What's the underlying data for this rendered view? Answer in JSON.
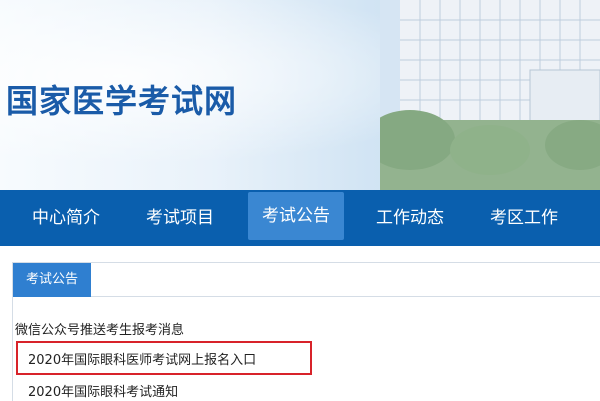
{
  "header": {
    "site_title": "国家医学考试网"
  },
  "nav": {
    "items": [
      {
        "label": "中心简介",
        "active": false
      },
      {
        "label": "考试项目",
        "active": false
      },
      {
        "label": "考试公告",
        "active": true
      },
      {
        "label": "工作动态",
        "active": false
      },
      {
        "label": "考区工作",
        "active": false
      }
    ]
  },
  "section": {
    "tab_label": "考试公告",
    "notices": [
      "微信公众号推送考生报考消息",
      "2020年国际眼科医师考试网上报名入口",
      "2020年国际眼科考试通知"
    ]
  },
  "colors": {
    "nav_bg": "#0a5fae",
    "nav_active_bg": "#3a87d2",
    "title": "#1a5ba8",
    "highlight_border": "#d8232a"
  }
}
